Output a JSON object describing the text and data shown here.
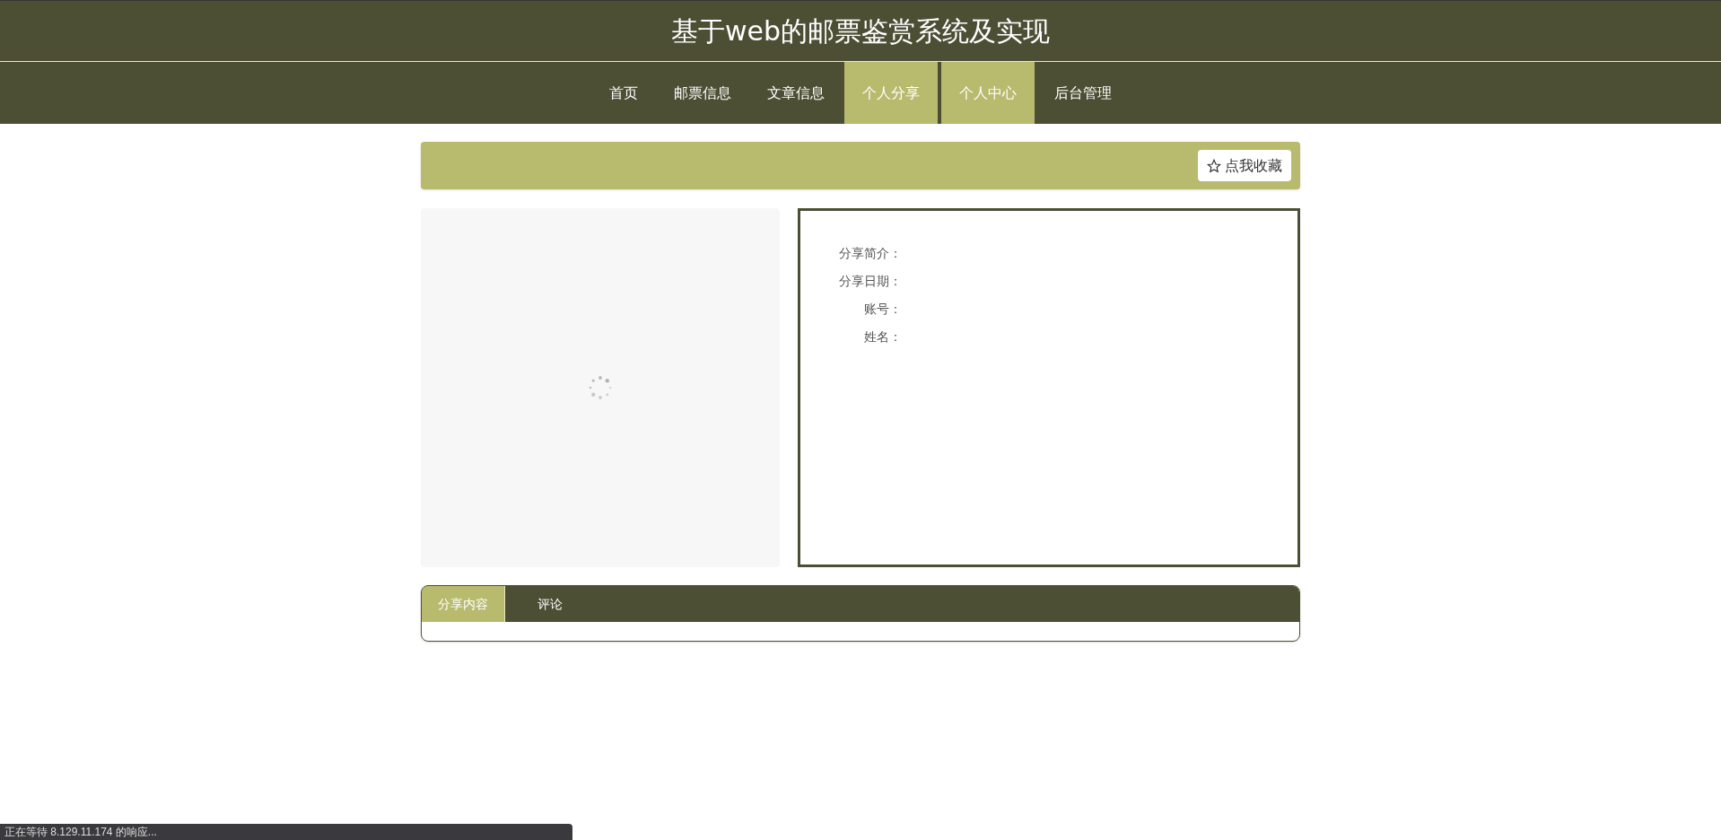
{
  "header": {
    "title": "基于web的邮票鉴赏系统及实现"
  },
  "nav": [
    {
      "label": "首页",
      "selected": false
    },
    {
      "label": "邮票信息",
      "selected": false
    },
    {
      "label": "文章信息",
      "selected": false
    },
    {
      "label": "个人分享",
      "selected": true
    },
    {
      "label": "个人中心",
      "selected": true
    },
    {
      "label": "后台管理",
      "selected": false
    }
  ],
  "favorite_button": {
    "label": "点我收藏"
  },
  "image": {
    "loading": true
  },
  "details": [
    {
      "label": "分享简介："
    },
    {
      "label": "分享日期："
    },
    {
      "label": "账号："
    },
    {
      "label": "姓名："
    }
  ],
  "tabs": [
    {
      "label": "分享内容",
      "selected": true
    },
    {
      "label": "评论",
      "selected": false
    }
  ],
  "status_bar": {
    "text": "正在等待 8.129.11.174 的响应..."
  }
}
